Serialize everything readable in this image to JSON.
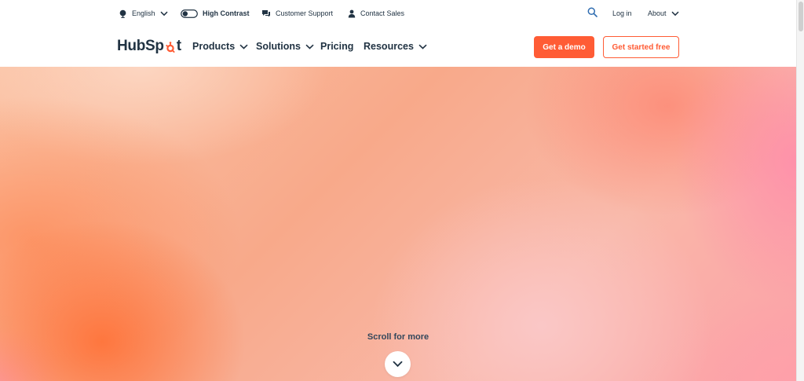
{
  "utility": {
    "language": "English",
    "high_contrast": "High Contrast",
    "customer_support": "Customer Support",
    "contact_sales": "Contact Sales",
    "login": "Log in",
    "about": "About"
  },
  "nav": {
    "logo_prefix": "HubSp",
    "logo_suffix": "t",
    "products": "Products",
    "solutions": "Solutions",
    "pricing": "Pricing",
    "resources": "Resources",
    "demo_button": "Get a demo",
    "free_button": "Get started free"
  },
  "hero": {
    "scroll_text": "Scroll for more"
  },
  "colors": {
    "brand_orange": "#ff5c35",
    "text_dark": "#213343"
  }
}
